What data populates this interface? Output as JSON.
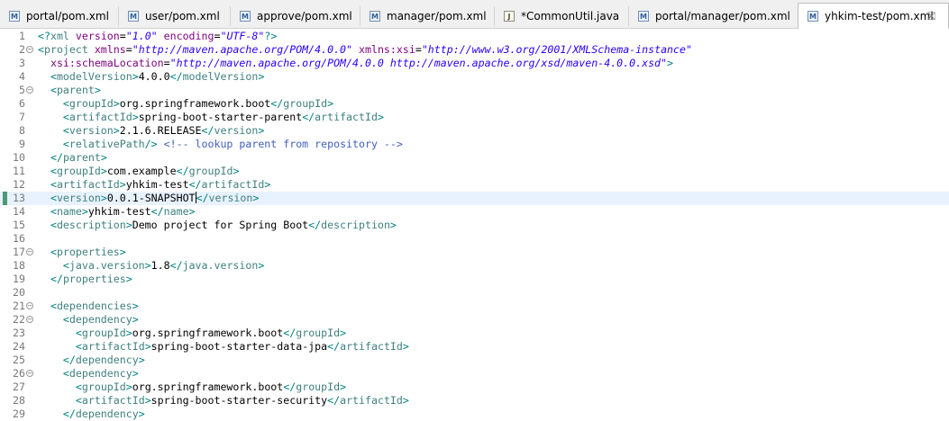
{
  "tabs": [
    {
      "label": "portal/pom.xml",
      "icon": "maven-file-icon",
      "active": false
    },
    {
      "label": "user/pom.xml",
      "icon": "maven-file-icon",
      "active": false
    },
    {
      "label": "approve/pom.xml",
      "icon": "maven-file-icon",
      "active": false
    },
    {
      "label": "manager/pom.xml",
      "icon": "maven-file-icon",
      "active": false
    },
    {
      "label": "*CommonUtil.java",
      "icon": "java-file-icon",
      "active": false
    },
    {
      "label": "portal/manager/pom.xml",
      "icon": "maven-file-icon",
      "active": false
    },
    {
      "label": "yhkim-test/pom.xml",
      "icon": "maven-file-icon",
      "active": true
    }
  ],
  "close_symbol": "⛝",
  "editor": {
    "current_line": 13,
    "lines": [
      {
        "n": "1",
        "fold": "",
        "segs": [
          [
            "p",
            "<?"
          ],
          [
            "t",
            "xml "
          ],
          [
            "a",
            "version"
          ],
          [
            "x",
            "="
          ],
          [
            "v",
            "\"1.0\""
          ],
          [
            "x",
            " "
          ],
          [
            "a",
            "encoding"
          ],
          [
            "x",
            "="
          ],
          [
            "v",
            "\"UTF-8\""
          ],
          [
            "p",
            "?>"
          ]
        ]
      },
      {
        "n": "2",
        "fold": "−",
        "segs": [
          [
            "p",
            "<"
          ],
          [
            "t",
            "project "
          ],
          [
            "a",
            "xmlns"
          ],
          [
            "x",
            "="
          ],
          [
            "v",
            "\"http://maven.apache.org/POM/4.0.0\""
          ],
          [
            "x",
            " "
          ],
          [
            "a",
            "xmlns:xsi"
          ],
          [
            "x",
            "="
          ],
          [
            "v",
            "\"http://www.w3.org/2001/XMLSchema-instance\""
          ]
        ]
      },
      {
        "n": "3",
        "fold": "",
        "segs": [
          [
            "x",
            "  "
          ],
          [
            "a",
            "xsi:schemaLocation"
          ],
          [
            "x",
            "="
          ],
          [
            "v",
            "\"http://maven.apache.org/POM/4.0.0 http://maven.apache.org/xsd/maven-4.0.0.xsd\""
          ],
          [
            "p",
            ">"
          ]
        ]
      },
      {
        "n": "4",
        "fold": "",
        "segs": [
          [
            "x",
            "  "
          ],
          [
            "p",
            "<"
          ],
          [
            "t",
            "modelVersion"
          ],
          [
            "p",
            ">"
          ],
          [
            "x",
            "4.0.0"
          ],
          [
            "p",
            "</"
          ],
          [
            "t",
            "modelVersion"
          ],
          [
            "p",
            ">"
          ]
        ]
      },
      {
        "n": "5",
        "fold": "−",
        "segs": [
          [
            "x",
            "  "
          ],
          [
            "p",
            "<"
          ],
          [
            "t",
            "parent"
          ],
          [
            "p",
            ">"
          ]
        ]
      },
      {
        "n": "6",
        "fold": "",
        "segs": [
          [
            "x",
            "    "
          ],
          [
            "p",
            "<"
          ],
          [
            "t",
            "groupId"
          ],
          [
            "p",
            ">"
          ],
          [
            "x",
            "org.springframework.boot"
          ],
          [
            "p",
            "</"
          ],
          [
            "t",
            "groupId"
          ],
          [
            "p",
            ">"
          ]
        ]
      },
      {
        "n": "7",
        "fold": "",
        "segs": [
          [
            "x",
            "    "
          ],
          [
            "p",
            "<"
          ],
          [
            "t",
            "artifactId"
          ],
          [
            "p",
            ">"
          ],
          [
            "x",
            "spring-boot-starter-parent"
          ],
          [
            "p",
            "</"
          ],
          [
            "t",
            "artifactId"
          ],
          [
            "p",
            ">"
          ]
        ]
      },
      {
        "n": "8",
        "fold": "",
        "segs": [
          [
            "x",
            "    "
          ],
          [
            "p",
            "<"
          ],
          [
            "t",
            "version"
          ],
          [
            "p",
            ">"
          ],
          [
            "x",
            "2.1.6.RELEASE"
          ],
          [
            "p",
            "</"
          ],
          [
            "t",
            "version"
          ],
          [
            "p",
            ">"
          ]
        ]
      },
      {
        "n": "9",
        "fold": "",
        "segs": [
          [
            "x",
            "    "
          ],
          [
            "p",
            "<"
          ],
          [
            "t",
            "relativePath"
          ],
          [
            "p",
            "/>"
          ],
          [
            "x",
            " "
          ],
          [
            "c",
            "<!-- lookup parent from repository -->"
          ]
        ]
      },
      {
        "n": "10",
        "fold": "",
        "segs": [
          [
            "x",
            "  "
          ],
          [
            "p",
            "</"
          ],
          [
            "t",
            "parent"
          ],
          [
            "p",
            ">"
          ]
        ]
      },
      {
        "n": "11",
        "fold": "",
        "segs": [
          [
            "x",
            "  "
          ],
          [
            "p",
            "<"
          ],
          [
            "t",
            "groupId"
          ],
          [
            "p",
            ">"
          ],
          [
            "x",
            "com.example"
          ],
          [
            "p",
            "</"
          ],
          [
            "t",
            "groupId"
          ],
          [
            "p",
            ">"
          ]
        ]
      },
      {
        "n": "12",
        "fold": "",
        "segs": [
          [
            "x",
            "  "
          ],
          [
            "p",
            "<"
          ],
          [
            "t",
            "artifactId"
          ],
          [
            "p",
            ">"
          ],
          [
            "x",
            "yhkim-test"
          ],
          [
            "p",
            "</"
          ],
          [
            "t",
            "artifactId"
          ],
          [
            "p",
            ">"
          ]
        ]
      },
      {
        "n": "13",
        "fold": "",
        "segs": [
          [
            "x",
            "  "
          ],
          [
            "p",
            "<"
          ],
          [
            "t",
            "version"
          ],
          [
            "p",
            ">"
          ],
          [
            "x",
            "0.0.1-SNAPSHOT"
          ],
          [
            "cur",
            ""
          ],
          [
            "p",
            "</"
          ],
          [
            "t",
            "version"
          ],
          [
            "p",
            ">"
          ]
        ]
      },
      {
        "n": "14",
        "fold": "",
        "segs": [
          [
            "x",
            "  "
          ],
          [
            "p",
            "<"
          ],
          [
            "t",
            "name"
          ],
          [
            "p",
            ">"
          ],
          [
            "x",
            "yhkim-test"
          ],
          [
            "p",
            "</"
          ],
          [
            "t",
            "name"
          ],
          [
            "p",
            ">"
          ]
        ]
      },
      {
        "n": "15",
        "fold": "",
        "segs": [
          [
            "x",
            "  "
          ],
          [
            "p",
            "<"
          ],
          [
            "t",
            "description"
          ],
          [
            "p",
            ">"
          ],
          [
            "x",
            "Demo project for Spring Boot"
          ],
          [
            "p",
            "</"
          ],
          [
            "t",
            "description"
          ],
          [
            "p",
            ">"
          ]
        ]
      },
      {
        "n": "16",
        "fold": "",
        "segs": []
      },
      {
        "n": "17",
        "fold": "−",
        "segs": [
          [
            "x",
            "  "
          ],
          [
            "p",
            "<"
          ],
          [
            "t",
            "properties"
          ],
          [
            "p",
            ">"
          ]
        ]
      },
      {
        "n": "18",
        "fold": "",
        "segs": [
          [
            "x",
            "    "
          ],
          [
            "p",
            "<"
          ],
          [
            "t",
            "java.version"
          ],
          [
            "p",
            ">"
          ],
          [
            "x",
            "1.8"
          ],
          [
            "p",
            "</"
          ],
          [
            "t",
            "java.version"
          ],
          [
            "p",
            ">"
          ]
        ]
      },
      {
        "n": "19",
        "fold": "",
        "segs": [
          [
            "x",
            "  "
          ],
          [
            "p",
            "</"
          ],
          [
            "t",
            "properties"
          ],
          [
            "p",
            ">"
          ]
        ]
      },
      {
        "n": "20",
        "fold": "",
        "segs": []
      },
      {
        "n": "21",
        "fold": "−",
        "segs": [
          [
            "x",
            "  "
          ],
          [
            "p",
            "<"
          ],
          [
            "t",
            "dependencies"
          ],
          [
            "p",
            ">"
          ]
        ]
      },
      {
        "n": "22",
        "fold": "−",
        "segs": [
          [
            "x",
            "    "
          ],
          [
            "p",
            "<"
          ],
          [
            "t",
            "dependency"
          ],
          [
            "p",
            ">"
          ]
        ]
      },
      {
        "n": "23",
        "fold": "",
        "segs": [
          [
            "x",
            "      "
          ],
          [
            "p",
            "<"
          ],
          [
            "t",
            "groupId"
          ],
          [
            "p",
            ">"
          ],
          [
            "x",
            "org.springframework.boot"
          ],
          [
            "p",
            "</"
          ],
          [
            "t",
            "groupId"
          ],
          [
            "p",
            ">"
          ]
        ]
      },
      {
        "n": "24",
        "fold": "",
        "segs": [
          [
            "x",
            "      "
          ],
          [
            "p",
            "<"
          ],
          [
            "t",
            "artifactId"
          ],
          [
            "p",
            ">"
          ],
          [
            "x",
            "spring-boot-starter-data-jpa"
          ],
          [
            "p",
            "</"
          ],
          [
            "t",
            "artifactId"
          ],
          [
            "p",
            ">"
          ]
        ]
      },
      {
        "n": "25",
        "fold": "",
        "segs": [
          [
            "x",
            "    "
          ],
          [
            "p",
            "</"
          ],
          [
            "t",
            "dependency"
          ],
          [
            "p",
            ">"
          ]
        ]
      },
      {
        "n": "26",
        "fold": "−",
        "segs": [
          [
            "x",
            "    "
          ],
          [
            "p",
            "<"
          ],
          [
            "t",
            "dependency"
          ],
          [
            "p",
            ">"
          ]
        ]
      },
      {
        "n": "27",
        "fold": "",
        "segs": [
          [
            "x",
            "      "
          ],
          [
            "p",
            "<"
          ],
          [
            "t",
            "groupId"
          ],
          [
            "p",
            ">"
          ],
          [
            "x",
            "org.springframework.boot"
          ],
          [
            "p",
            "</"
          ],
          [
            "t",
            "groupId"
          ],
          [
            "p",
            ">"
          ]
        ]
      },
      {
        "n": "28",
        "fold": "",
        "segs": [
          [
            "x",
            "      "
          ],
          [
            "p",
            "<"
          ],
          [
            "t",
            "artifactId"
          ],
          [
            "p",
            ">"
          ],
          [
            "x",
            "spring-boot-starter-security"
          ],
          [
            "p",
            "</"
          ],
          [
            "t",
            "artifactId"
          ],
          [
            "p",
            ">"
          ]
        ]
      },
      {
        "n": "29",
        "fold": "",
        "segs": [
          [
            "x",
            "    "
          ],
          [
            "p",
            "</"
          ],
          [
            "t",
            "dependency"
          ],
          [
            "p",
            ">"
          ]
        ]
      }
    ]
  }
}
